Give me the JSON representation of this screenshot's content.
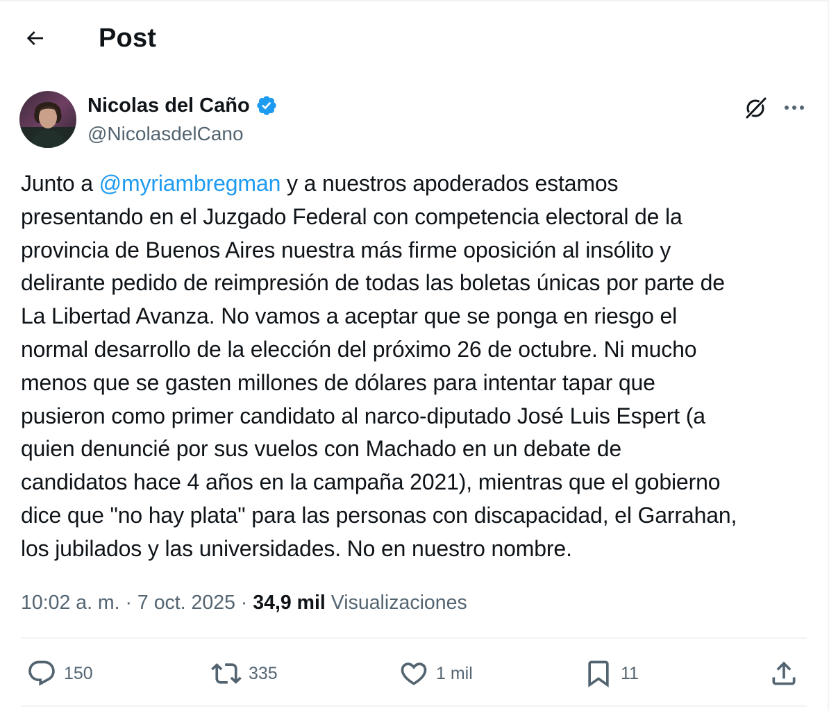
{
  "header": {
    "title": "Post",
    "back_icon": "arrow-left-icon"
  },
  "author": {
    "name": "Nicolas del Caño",
    "handle": "@NicolasdelCano",
    "verified_icon": "verified-badge-icon",
    "verified_color": "#1d9bf0"
  },
  "post": {
    "text_before_mention": "Junto a ",
    "mention": "@myriambregman",
    "text_after_mention": " y a nuestros apoderados estamos\npresentando en el Juzgado Federal con competencia electoral de la\nprovincia de Buenos Aires nuestra más firme oposición al insólito y\ndelirante pedido de reimpresión de todas las boletas únicas por parte de\nLa Libertad Avanza. No vamos a aceptar que se ponga en riesgo el\nnormal desarrollo de la elección del próximo 26 de octubre. Ni mucho\nmenos que se gasten millones de dólares para intentar tapar que\npusieron como primer candidato al narco-diputado  José Luis Espert (a\nquien denuncié por sus vuelos con Machado en un debate de\ncandidatos hace 4 años en la campaña 2021), mientras que el gobierno\ndice que \"no hay plata\" para las personas con discapacidad, el Garrahan,\nlos jubilados y las universidades. No en nuestro nombre.",
    "mention_color": "#1d9bf0"
  },
  "meta": {
    "time": "10:02 a. m.",
    "separator": " · ",
    "date": "7 oct. 2025",
    "views_count": "34,9 mil",
    "views_label": "Visualizaciones"
  },
  "actions": {
    "replies": "150",
    "reposts": "335",
    "likes": "1 mil",
    "bookmarks": "11"
  },
  "icons": [
    "arrow-left-icon",
    "grok-icon",
    "more-icon",
    "reply-icon",
    "repost-icon",
    "like-icon",
    "bookmark-icon",
    "share-icon"
  ]
}
